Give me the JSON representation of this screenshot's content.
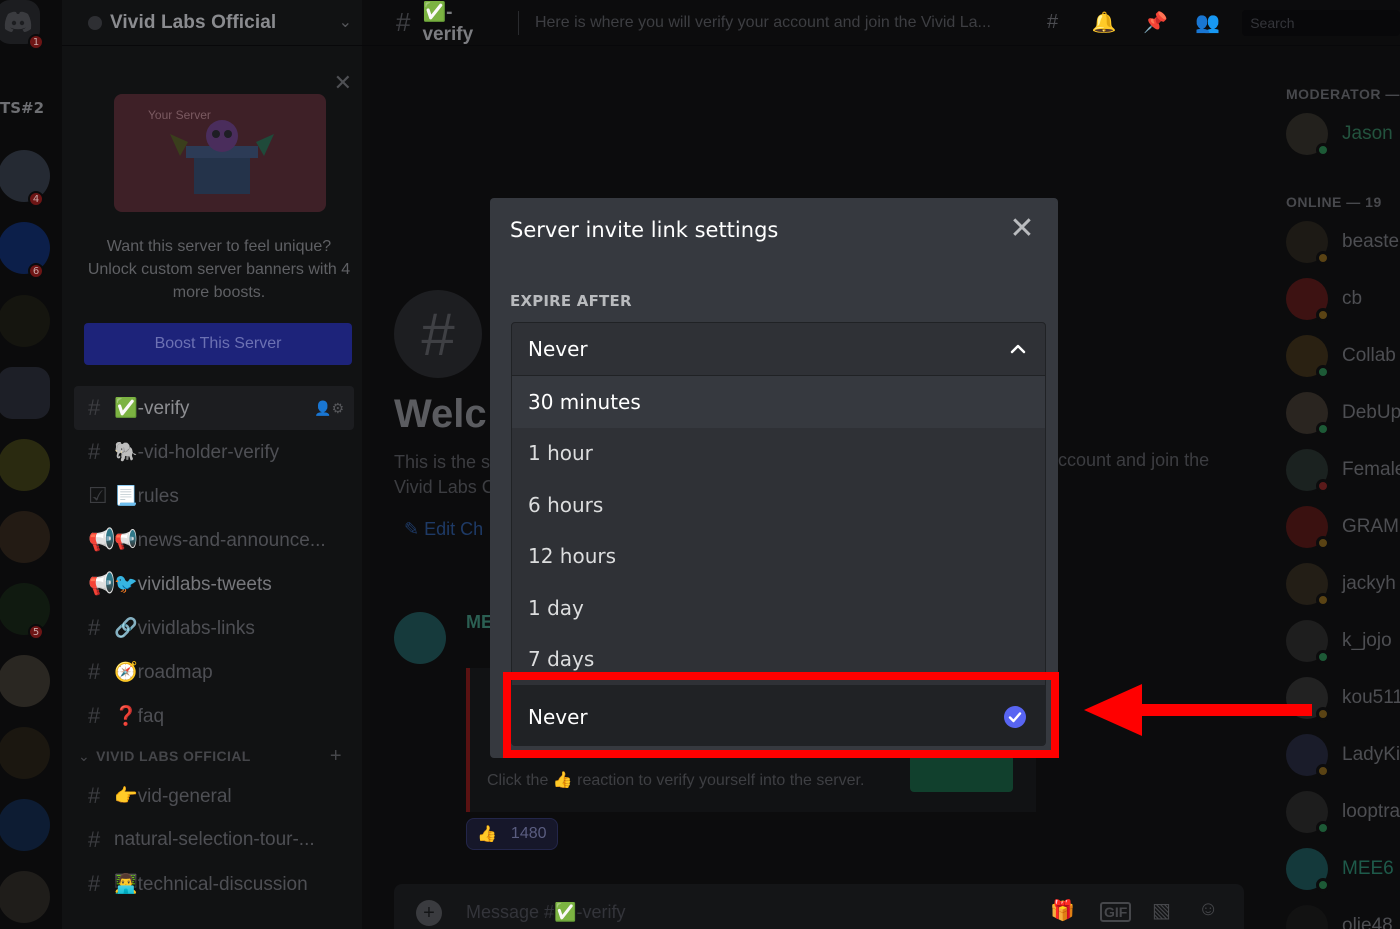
{
  "rail": {
    "home_badge": "1",
    "folder_tag": "TS#2",
    "server_badges": [
      "4",
      "6",
      "5"
    ]
  },
  "sidebar": {
    "server_name": "Vivid Labs Official",
    "boost_card": {
      "preview_label": "Your Server",
      "text": "Want this server to feel unique? Unlock custom server banners with 4 more boosts.",
      "button": "Boost This Server"
    },
    "channels": [
      {
        "label": "✅-verify",
        "active": true
      },
      {
        "label": "🐘-vid-holder-verify"
      },
      {
        "label": "📃rules"
      },
      {
        "label": "📢news-and-announce..."
      },
      {
        "label": "🐦vividlabs-tweets",
        "bright": true
      },
      {
        "label": "🔗vividlabs-links"
      },
      {
        "label": "🧭roadmap"
      },
      {
        "label": "❓faq"
      }
    ],
    "category": "VIVID LABS OFFICIAL",
    "channels2": [
      {
        "label": "👉vid-general"
      },
      {
        "label": "natural-selection-tour-..."
      },
      {
        "label": "👨‍💻technical-discussion"
      }
    ]
  },
  "topbar": {
    "channel": "✅-verify",
    "topic": "Here is where you will verify your account and join the Vivid La...",
    "search_placeholder": "Search"
  },
  "main": {
    "welcome_title": "Welc",
    "welcome_sub": "This is the s",
    "welcome_sub2": "Vivid Labs C",
    "welcome_sub_right": "ccount and join the",
    "edit_channel": "✎ Edit Ch",
    "msg_author": "ME",
    "embed_desc": "Click the 👍 reaction to verify yourself into the server.",
    "reaction_count": "1480",
    "composer_placeholder": "Message #✅-verify"
  },
  "members": {
    "groups": [
      "MODERATOR —",
      "ONLINE — 19"
    ],
    "list": [
      "Jason",
      "beaste",
      "cb",
      "Collab",
      "DebUp",
      "Female",
      "GRAM",
      "jackyh",
      "k_jojo",
      "kou511",
      "LadyKi",
      "looptra",
      "MEE6",
      "olie48"
    ]
  },
  "modal": {
    "title": "Server invite link settings",
    "expire_label": "EXPIRE AFTER",
    "selected_value": "Never",
    "options": [
      "30 minutes",
      "1 hour",
      "6 hours",
      "12 hours",
      "1 day",
      "7 days",
      "Never"
    ],
    "selected_index": 6,
    "hover_index": 0
  },
  "colors": {
    "annotation": "#ff0000",
    "check": "#5865f2",
    "modal_bg": "#36393f",
    "dropdown_bg": "#2f3136"
  }
}
